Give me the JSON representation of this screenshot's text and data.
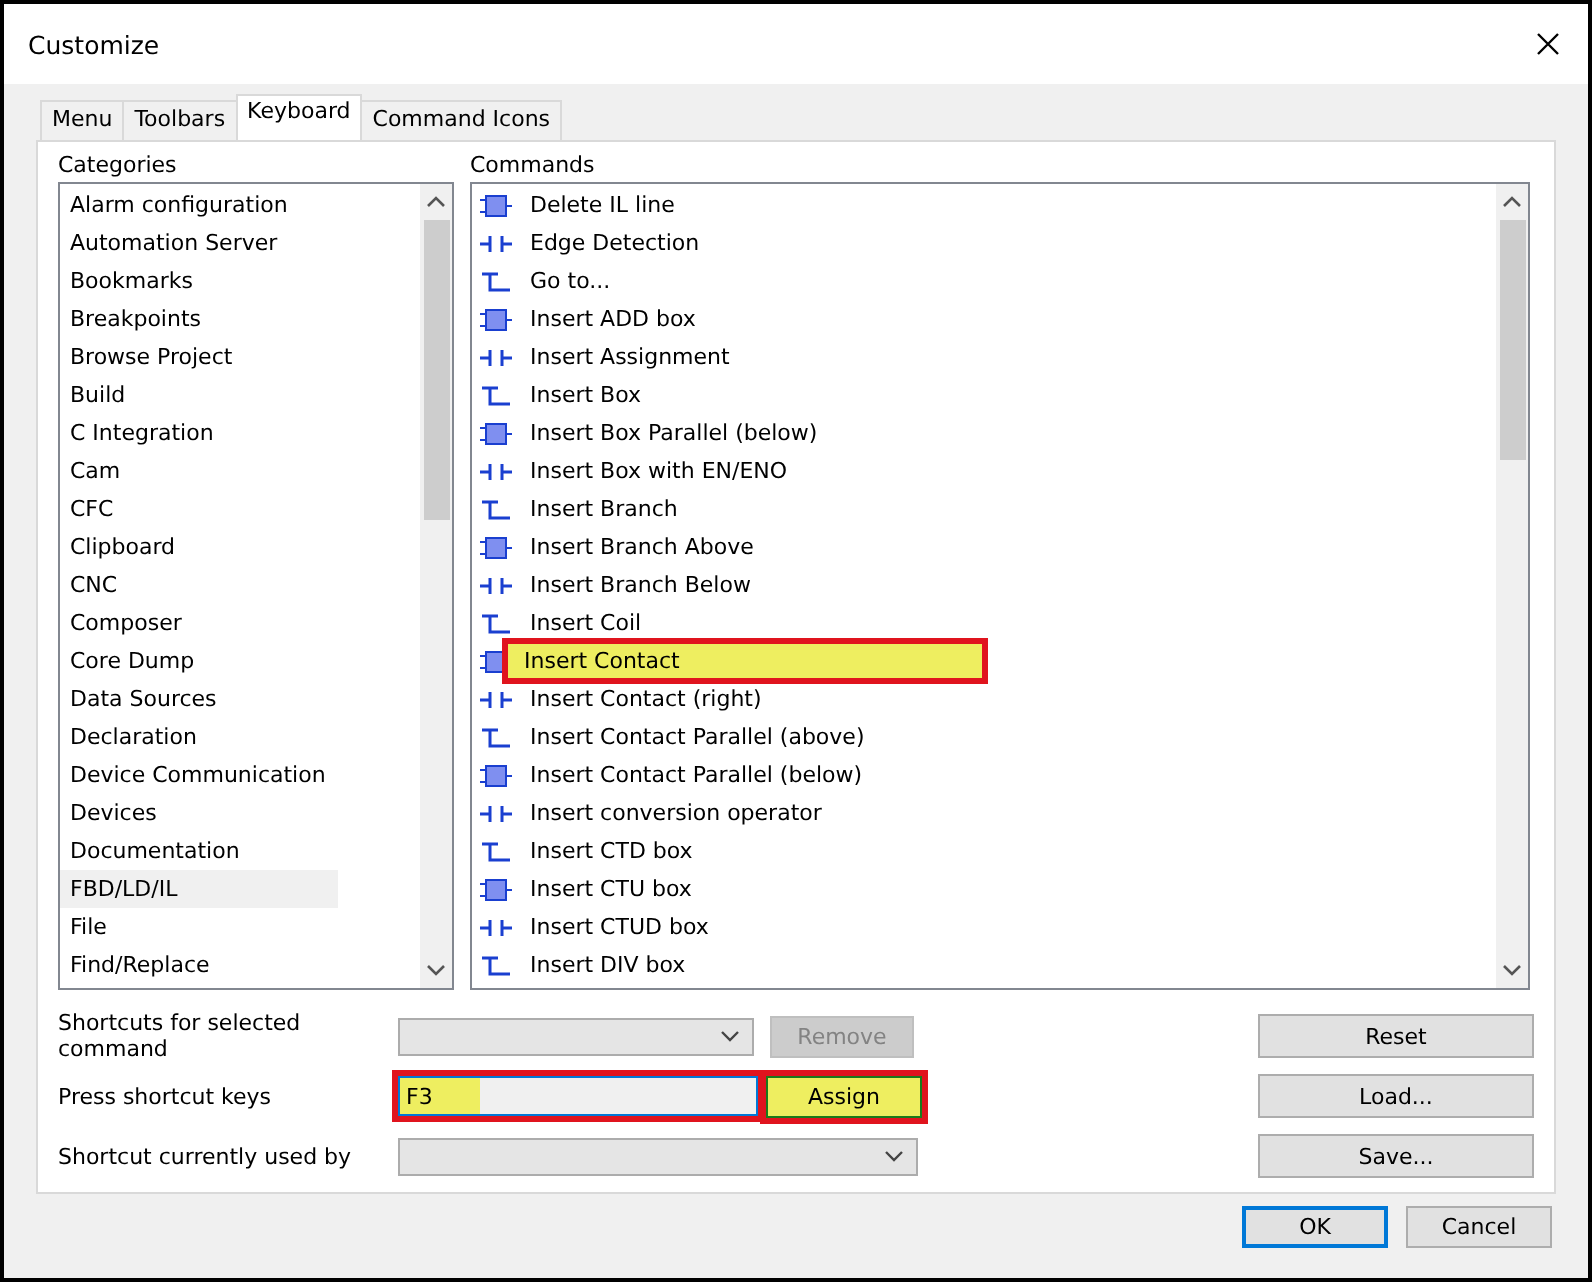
{
  "window": {
    "title": "Customize"
  },
  "tabs": [
    {
      "label": "Menu",
      "selected": false
    },
    {
      "label": "Toolbars",
      "selected": false
    },
    {
      "label": "Keyboard",
      "selected": true
    },
    {
      "label": "Command Icons",
      "selected": false
    }
  ],
  "categories": {
    "label": "Categories",
    "items": [
      {
        "label": "Alarm configuration",
        "selected": false
      },
      {
        "label": "Automation Server",
        "selected": false
      },
      {
        "label": "Bookmarks",
        "selected": false
      },
      {
        "label": "Breakpoints",
        "selected": false
      },
      {
        "label": "Browse Project",
        "selected": false
      },
      {
        "label": "Build",
        "selected": false
      },
      {
        "label": "C Integration",
        "selected": false
      },
      {
        "label": "Cam",
        "selected": false
      },
      {
        "label": "CFC",
        "selected": false
      },
      {
        "label": "Clipboard",
        "selected": false
      },
      {
        "label": "CNC",
        "selected": false
      },
      {
        "label": "Composer",
        "selected": false
      },
      {
        "label": "Core Dump",
        "selected": false
      },
      {
        "label": "Data Sources",
        "selected": false
      },
      {
        "label": "Declaration",
        "selected": false
      },
      {
        "label": "Device Communication",
        "selected": false
      },
      {
        "label": "Devices",
        "selected": false
      },
      {
        "label": "Documentation",
        "selected": false
      },
      {
        "label": "FBD/LD/IL",
        "selected": true
      },
      {
        "label": "File",
        "selected": false
      },
      {
        "label": "Find/Replace",
        "selected": false
      }
    ]
  },
  "commands": {
    "label": "Commands",
    "items": [
      {
        "label": "Delete IL line",
        "selected": false
      },
      {
        "label": "Edge Detection",
        "selected": false
      },
      {
        "label": "Go to...",
        "selected": false
      },
      {
        "label": "Insert ADD box",
        "selected": false
      },
      {
        "label": "Insert Assignment",
        "selected": false
      },
      {
        "label": "Insert Box",
        "selected": false
      },
      {
        "label": "Insert Box Parallel (below)",
        "selected": false
      },
      {
        "label": "Insert Box with EN/ENO",
        "selected": false
      },
      {
        "label": "Insert Branch",
        "selected": false
      },
      {
        "label": "Insert Branch Above",
        "selected": false
      },
      {
        "label": "Insert Branch Below",
        "selected": false
      },
      {
        "label": "Insert Coil",
        "selected": false
      },
      {
        "label": "Insert Contact",
        "selected": true
      },
      {
        "label": "Insert Contact (right)",
        "selected": false
      },
      {
        "label": "Insert Contact Parallel (above)",
        "selected": false
      },
      {
        "label": "Insert Contact Parallel (below)",
        "selected": false
      },
      {
        "label": "Insert conversion operator",
        "selected": false
      },
      {
        "label": "Insert CTD box",
        "selected": false
      },
      {
        "label": "Insert CTU box",
        "selected": false
      },
      {
        "label": "Insert CTUD box",
        "selected": false
      },
      {
        "label": "Insert DIV box",
        "selected": false
      }
    ]
  },
  "shortcuts_label": "Shortcuts for selected command",
  "remove_button": {
    "label": "Remove",
    "disabled": true
  },
  "press_label": "Press shortcut keys",
  "shortcut_field": {
    "value": "F3",
    "highlighted": true
  },
  "assign_button": {
    "label": "Assign",
    "highlighted": true
  },
  "used_by_label": "Shortcut currently used by",
  "side_buttons": [
    "Reset",
    "Load...",
    "Save..."
  ],
  "buttons": [
    {
      "label": "OK",
      "default": true
    },
    {
      "label": "Cancel",
      "default": false
    }
  ]
}
